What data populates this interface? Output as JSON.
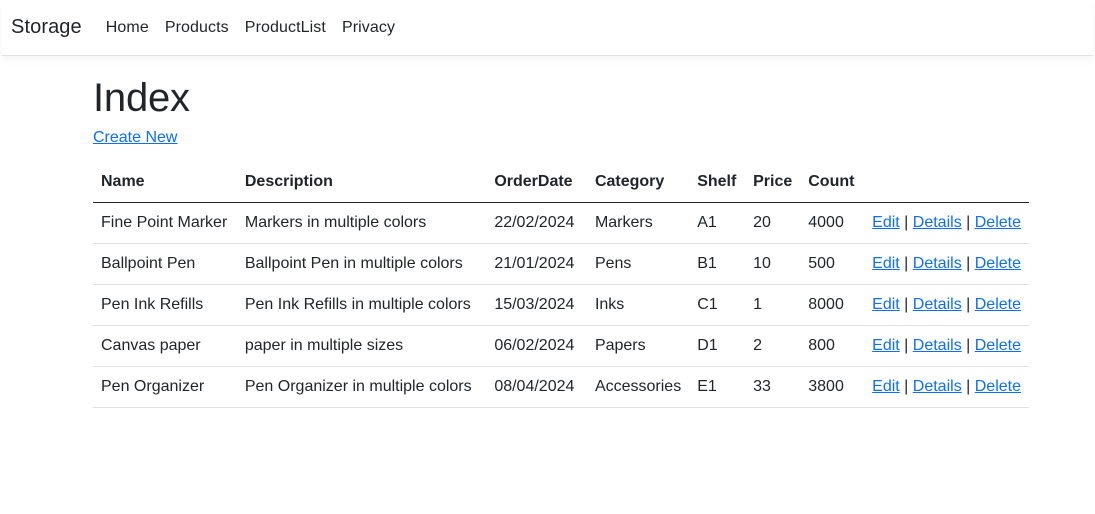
{
  "navbar": {
    "brand": "Storage",
    "links": [
      "Home",
      "Products",
      "ProductList",
      "Privacy"
    ]
  },
  "page": {
    "title": "Index",
    "create_new_label": "Create New"
  },
  "table": {
    "headers": [
      "Name",
      "Description",
      "OrderDate",
      "Category",
      "Shelf",
      "Price",
      "Count",
      ""
    ],
    "rows": [
      {
        "name": "Fine Point Marker",
        "description": "Markers in multiple colors",
        "order_date": "22/02/2024",
        "category": "Markers",
        "shelf": "A1",
        "price": "20",
        "count": "4000"
      },
      {
        "name": "Ballpoint Pen",
        "description": "Ballpoint Pen in multiple colors",
        "order_date": "21/01/2024",
        "category": "Pens",
        "shelf": "B1",
        "price": "10",
        "count": "500"
      },
      {
        "name": "Pen Ink Refills",
        "description": "Pen Ink Refills in multiple colors",
        "order_date": "15/03/2024",
        "category": "Inks",
        "shelf": "C1",
        "price": "1",
        "count": "8000"
      },
      {
        "name": "Canvas paper",
        "description": "paper in multiple sizes",
        "order_date": "06/02/2024",
        "category": "Papers",
        "shelf": "D1",
        "price": "2",
        "count": "800"
      },
      {
        "name": "Pen Organizer",
        "description": "Pen Organizer in multiple colors",
        "order_date": "08/04/2024",
        "category": "Accessories",
        "shelf": "E1",
        "price": "33",
        "count": "3800"
      }
    ],
    "actions": {
      "edit": "Edit",
      "details": "Details",
      "delete": "Delete",
      "separator": "|"
    }
  },
  "colors": {
    "link": "#0d6efd",
    "text": "#212529",
    "border": "#dee2e6"
  }
}
